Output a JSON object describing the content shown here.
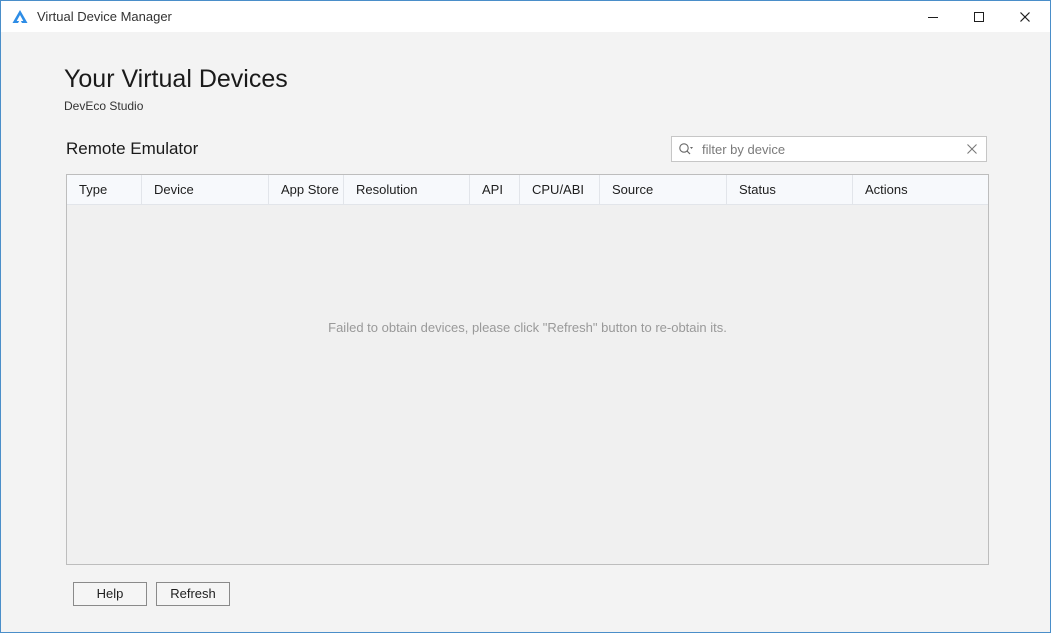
{
  "window": {
    "title": "Virtual Device Manager",
    "icon": "deveco-logo-icon",
    "controls": [
      "minimize-icon",
      "maximize-icon",
      "close-icon"
    ]
  },
  "page": {
    "title": "Your Virtual Devices",
    "subtitle": "DevEco Studio"
  },
  "section": {
    "title": "Remote Emulator"
  },
  "search": {
    "placeholder": "filter by device",
    "value": ""
  },
  "table": {
    "columns": [
      "Type",
      "Device",
      "App Store",
      "Resolution",
      "API",
      "CPU/ABI",
      "Source",
      "Status",
      "Actions"
    ],
    "rows": [],
    "empty_message": "Failed to obtain devices, please click \"Refresh\" button to re-obtain its."
  },
  "buttons": {
    "help": "Help",
    "refresh": "Refresh"
  },
  "colors": {
    "window_border": "#4a8ec9",
    "background": "#f3f3f3",
    "header_bg": "#f7f9fc",
    "logo_blue": "#2e8de6"
  }
}
